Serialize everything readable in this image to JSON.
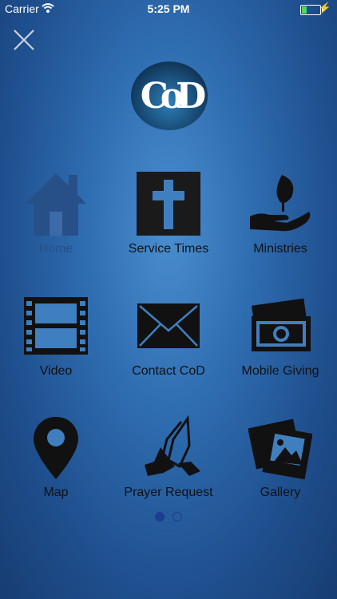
{
  "status": {
    "carrier": "Carrier",
    "time": "5:25 PM"
  },
  "logo": {
    "text": "CoD"
  },
  "menu": [
    {
      "label": "Home",
      "icon": "home-icon"
    },
    {
      "label": "Service Times",
      "icon": "cross-icon"
    },
    {
      "label": "Ministries",
      "icon": "hand-plant-icon"
    },
    {
      "label": "Video",
      "icon": "film-icon"
    },
    {
      "label": "Contact CoD",
      "icon": "envelope-icon"
    },
    {
      "label": "Mobile Giving",
      "icon": "money-icon"
    },
    {
      "label": "Map",
      "icon": "map-pin-icon"
    },
    {
      "label": "Prayer Request",
      "icon": "praying-hands-icon"
    },
    {
      "label": "Gallery",
      "icon": "photos-icon"
    }
  ],
  "pager": {
    "current": 1,
    "total": 2
  },
  "colors": {
    "accent": "#1d3d8f",
    "battery": "#4cd964"
  }
}
